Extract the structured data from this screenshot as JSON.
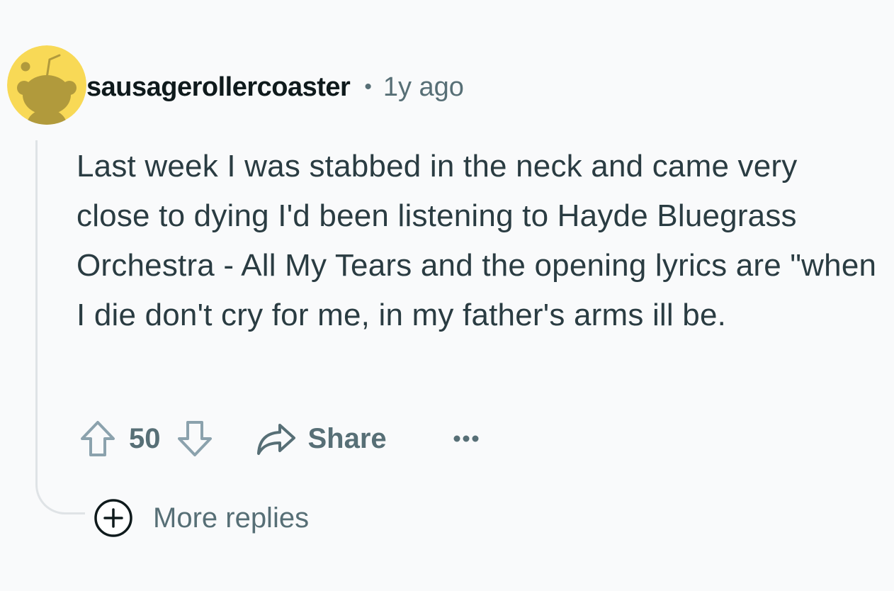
{
  "comment": {
    "author": "sausagerollercoaster",
    "separator": "•",
    "time_ago": "1y ago",
    "body": "Last week I was stabbed in the neck and came very close to dying I'd been listening to Hayde Bluegrass Orchestra - All My Tears and the opening lyrics are \"when I die don't cry for me, in my father's arms ill be.",
    "score": "50"
  },
  "actions": {
    "share_label": "Share",
    "more_replies_label": "More replies"
  },
  "icons": {
    "avatar": "snoo-avatar-icon",
    "upvote": "arrow-up-icon",
    "downvote": "arrow-down-icon",
    "share": "share-arrow-icon",
    "overflow": "ellipsis-icon",
    "expand": "plus-circle-icon"
  },
  "colors": {
    "background": "#f9fafb",
    "avatar_bg": "#f8d956",
    "avatar_figure": "#b19a3c",
    "text_primary": "#0f1a1c",
    "text_body": "#2a3c42",
    "text_secondary": "#576f76",
    "thread_line": "#dfe3e6"
  }
}
